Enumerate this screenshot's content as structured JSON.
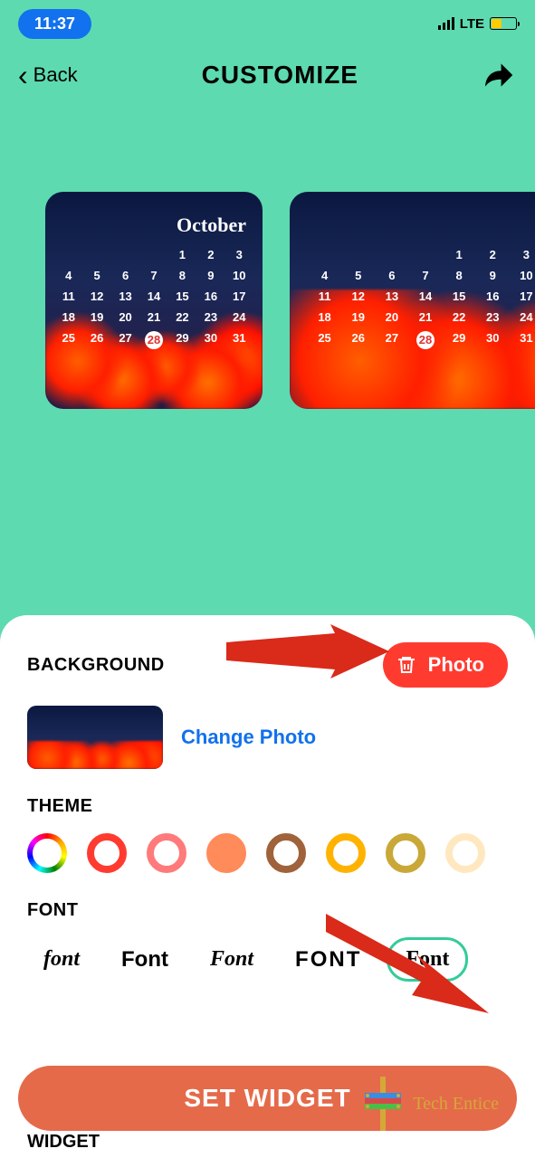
{
  "status": {
    "time": "11:37",
    "network": "LTE"
  },
  "header": {
    "back": "Back",
    "title": "CUSTOMIZE"
  },
  "preview": {
    "month": "October",
    "days": [
      "",
      "",
      "",
      "",
      "1",
      "2",
      "3",
      "4",
      "5",
      "6",
      "7",
      "8",
      "9",
      "10",
      "11",
      "12",
      "13",
      "14",
      "15",
      "16",
      "17",
      "18",
      "19",
      "20",
      "21",
      "22",
      "23",
      "24",
      "25",
      "26",
      "27",
      "28",
      "29",
      "30",
      "31"
    ],
    "today": "28"
  },
  "background": {
    "heading": "BACKGROUND",
    "photo_label": "Photo",
    "change_link": "Change Photo"
  },
  "theme": {
    "heading": "THEME"
  },
  "fonts": {
    "heading": "FONT",
    "items": [
      "font",
      "Font",
      "Font",
      "FONT",
      "Font"
    ]
  },
  "widget_heading": "WIDGET",
  "set_button": "SET WIDGET",
  "watermark": "Tech Entice"
}
